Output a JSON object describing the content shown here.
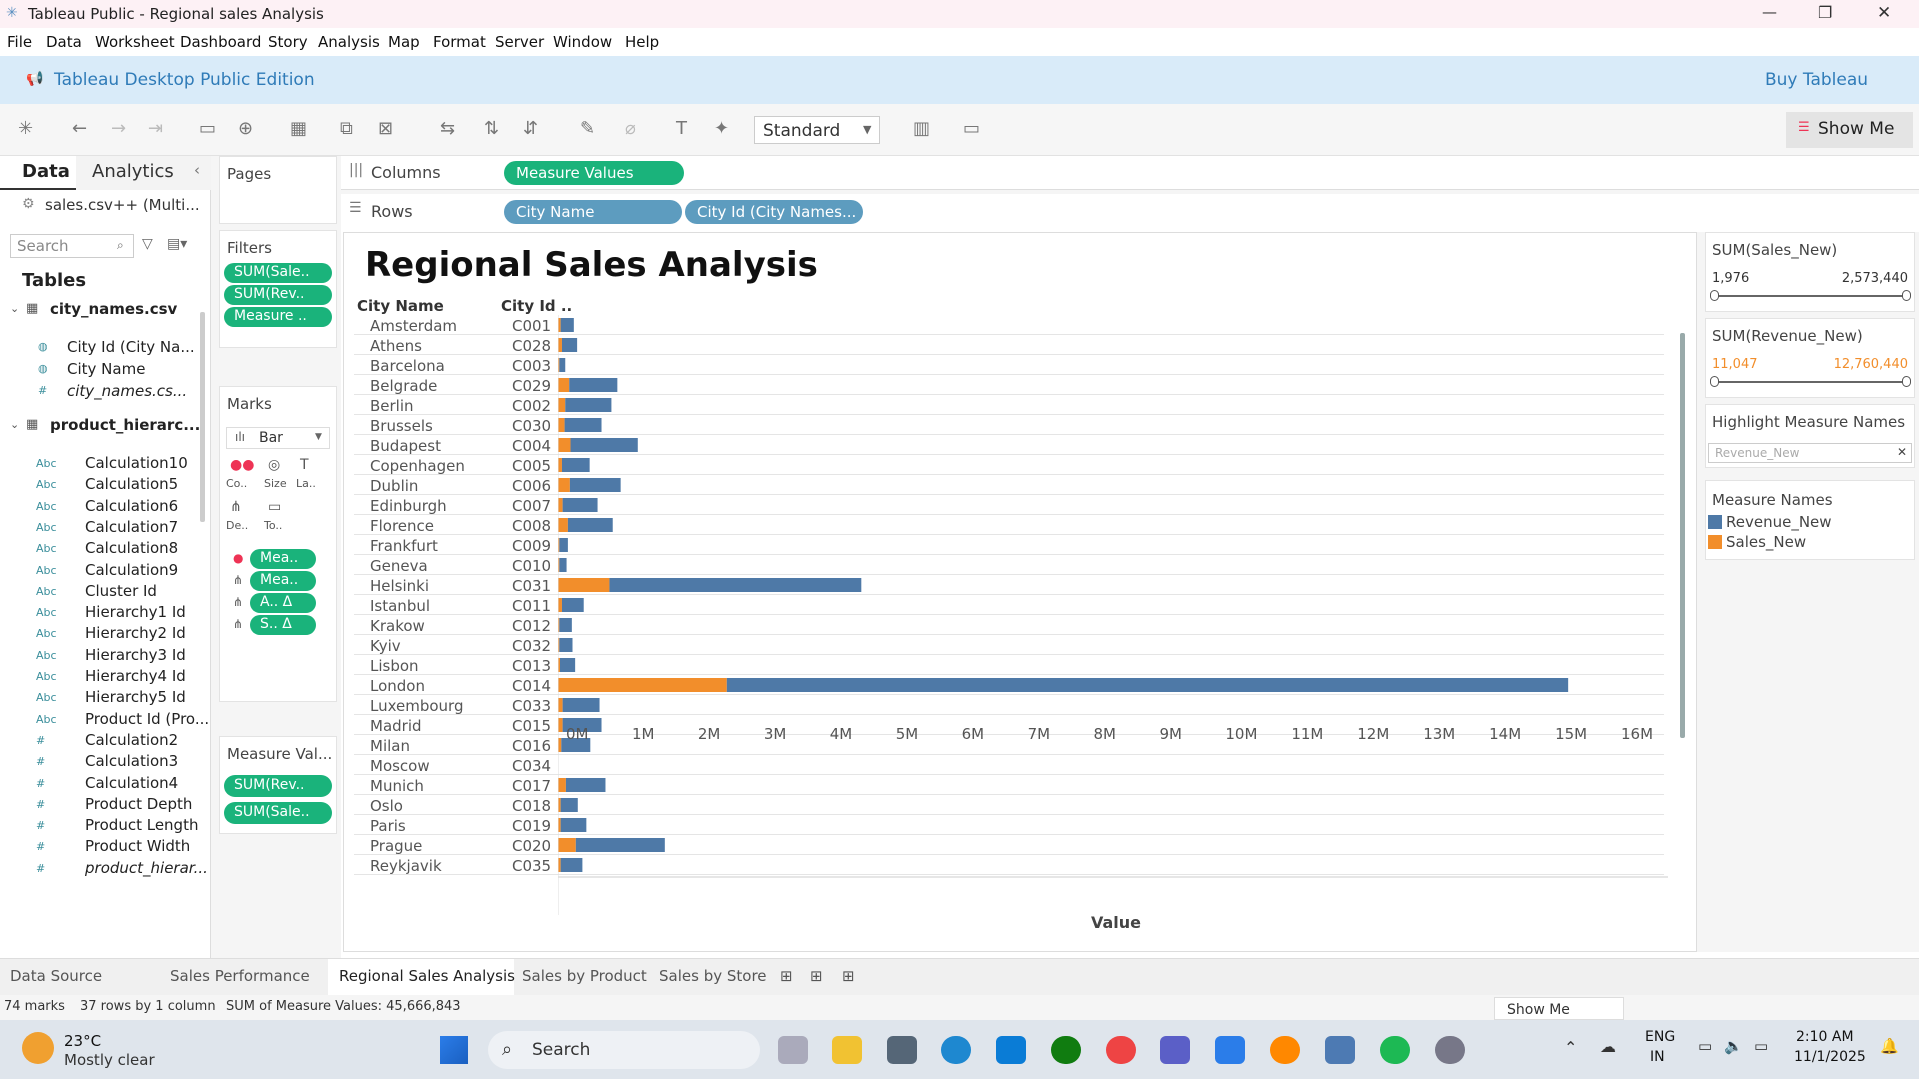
{
  "window": {
    "title": "Tableau Public - Regional sales Analysis",
    "minimize": "—",
    "restore": "❐",
    "close": "✕"
  },
  "menu": [
    "File",
    "Data",
    "Worksheet",
    "Dashboard",
    "Story",
    "Analysis",
    "Map",
    "Format",
    "Server",
    "Window",
    "Help"
  ],
  "banner": {
    "edition": "Tableau Desktop Public Edition",
    "buy": "Buy Tableau"
  },
  "toolbar": {
    "fit": "Standard",
    "show_me": "Show Me"
  },
  "left": {
    "tab_data": "Data",
    "tab_analytics": "Analytics",
    "source": "sales.csv++ (Multi...",
    "search_placeholder": "Search",
    "tables_heading": "Tables",
    "table1": "city_names.csv",
    "table1_fields": [
      "City Id (City Na...",
      "City Name",
      "city_names.cs..."
    ],
    "table2": "product_hierarc...",
    "table2_fields": [
      [
        "Abc",
        "Calculation10"
      ],
      [
        "Abc",
        "Calculation5"
      ],
      [
        "Abc",
        "Calculation6"
      ],
      [
        "Abc",
        "Calculation7"
      ],
      [
        "Abc",
        "Calculation8"
      ],
      [
        "Abc",
        "Calculation9"
      ],
      [
        "Abc",
        "Cluster Id"
      ],
      [
        "Abc",
        "Hierarchy1 Id"
      ],
      [
        "Abc",
        "Hierarchy2 Id"
      ],
      [
        "Abc",
        "Hierarchy3 Id"
      ],
      [
        "Abc",
        "Hierarchy4 Id"
      ],
      [
        "Abc",
        "Hierarchy5 Id"
      ],
      [
        "Abc",
        "Product Id (Pro..."
      ],
      [
        "#",
        "Calculation2"
      ],
      [
        "#",
        "Calculation3"
      ],
      [
        "#",
        "Calculation4"
      ],
      [
        "#",
        "Product Depth"
      ],
      [
        "#",
        "Product Length"
      ],
      [
        "#",
        "Product Width"
      ],
      [
        "#",
        "product_hierar..."
      ]
    ]
  },
  "pages": {
    "pages": "Pages",
    "filters": "Filters",
    "filter_pills": [
      "SUM(Sale..",
      "SUM(Rev..",
      "Measure .."
    ],
    "marks": "Marks",
    "mark_type": "Bar",
    "mark_buttons": [
      "Co..",
      "Size",
      "La..",
      "De..",
      "To.."
    ],
    "mark_pills": [
      "Mea..",
      "Mea..",
      "A..  Δ",
      "S..  Δ"
    ],
    "measure_values": "Measure Val...",
    "mv_pills": [
      "SUM(Rev..",
      "SUM(Sale.."
    ]
  },
  "shelves": {
    "columns": "Columns",
    "rows": "Rows",
    "columns_pill": "Measure Values",
    "rows_pills": [
      "City Name",
      "City Id (City Names..."
    ]
  },
  "viz": {
    "title": "Regional Sales Analysis",
    "col_city": "City Name",
    "col_id": "City Id ..",
    "xlabel": "Value"
  },
  "chart_data": {
    "type": "bar",
    "stacked": true,
    "title": "Regional Sales Analysis",
    "xlabel": "Value",
    "xlim": [
      0,
      16000000
    ],
    "xticks": [
      "0M",
      "1M",
      "2M",
      "3M",
      "4M",
      "5M",
      "6M",
      "7M",
      "8M",
      "9M",
      "10M",
      "11M",
      "12M",
      "13M",
      "14M",
      "15M",
      "16M"
    ],
    "categories": [
      "Amsterdam",
      "Athens",
      "Barcelona",
      "Belgrade",
      "Berlin",
      "Brussels",
      "Budapest",
      "Copenhagen",
      "Dublin",
      "Edinburgh",
      "Florence",
      "Frankfurt",
      "Geneva",
      "Helsinki",
      "Istanbul",
      "Krakow",
      "Kyiv",
      "Lisbon",
      "London",
      "Luxembourg",
      "Madrid",
      "Milan",
      "Moscow",
      "Munich",
      "Oslo",
      "Paris",
      "Prague",
      "Reykjavik"
    ],
    "ids": [
      "C001",
      "C028",
      "C003",
      "C029",
      "C002",
      "C030",
      "C004",
      "C005",
      "C006",
      "C007",
      "C008",
      "C009",
      "C010",
      "C031",
      "C011",
      "C012",
      "C032",
      "C013",
      "C014",
      "C033",
      "C015",
      "C016",
      "C034",
      "C017",
      "C018",
      "C019",
      "C020",
      "C035"
    ],
    "series": [
      {
        "name": "Sales_New",
        "color": "#f28e2b",
        "values": [
          40000,
          60000,
          20000,
          170000,
          110000,
          100000,
          190000,
          60000,
          180000,
          70000,
          150000,
          20000,
          20000,
          780000,
          60000,
          20000,
          20000,
          30000,
          2560000,
          70000,
          70000,
          50000,
          0,
          120000,
          40000,
          40000,
          270000,
          40000
        ]
      },
      {
        "name": "Revenue_New",
        "color": "#4e79a7",
        "values": [
          200000,
          230000,
          90000,
          730000,
          700000,
          560000,
          1020000,
          420000,
          770000,
          530000,
          680000,
          130000,
          110000,
          3820000,
          330000,
          190000,
          200000,
          230000,
          12760000,
          560000,
          590000,
          440000,
          0,
          600000,
          260000,
          390000,
          1350000,
          330000
        ]
      }
    ]
  },
  "right": {
    "f1_title": "SUM(Sales_New)",
    "f1_min": "1,976",
    "f1_max": "2,573,440",
    "f2_title": "SUM(Revenue_New)",
    "f2_min": "11,047",
    "f2_max": "12,760,440",
    "highlight_title": "Highlight Measure Names",
    "highlight_placeholder": "Revenue_New",
    "legend_title": "Measure Names",
    "legend": [
      "Revenue_New",
      "Sales_New"
    ]
  },
  "tabs": [
    "Data Source",
    "Sales Performance",
    "Regional Sales Analysis",
    "Sales by Product",
    "Sales by Store"
  ],
  "status": {
    "marks": "74 marks",
    "rows": "37 rows by 1 column",
    "sum": "SUM of Measure Values: 45,666,843",
    "showme": "Show Me"
  },
  "taskbar": {
    "temp": "23°C",
    "weather": "Mostly clear",
    "search": "Search",
    "lang1": "ENG",
    "lang2": "IN",
    "time": "2:10 AM",
    "date": "11/1/2025"
  }
}
